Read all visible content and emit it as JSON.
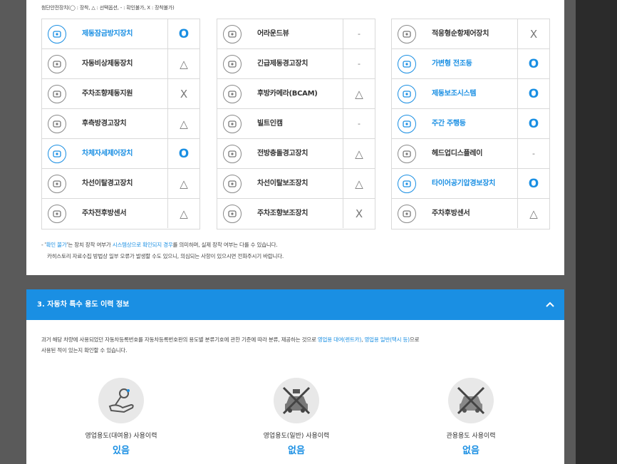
{
  "legend": "첨단안전장치(◯ : 장착, △ : 선택옵션, - : 확인불가, X : 장착불가)",
  "columns": [
    {
      "rows": [
        {
          "icon": "abs-icon",
          "label": "제동잠금방지장치",
          "value": "O",
          "highlight": true
        },
        {
          "icon": "emergency-brake-icon",
          "label": "자동비상제동장치",
          "value": "△",
          "highlight": false
        },
        {
          "icon": "steering-icon",
          "label": "주차조향제동지원",
          "value": "X",
          "highlight": false
        },
        {
          "icon": "rear-warning-icon",
          "label": "후측방경고장치",
          "value": "△",
          "highlight": false
        },
        {
          "icon": "stability-icon",
          "label": "차체자세제어장치",
          "value": "O",
          "highlight": true
        },
        {
          "icon": "lane-warning-icon",
          "label": "차선이탈경고장치",
          "value": "△",
          "highlight": false
        },
        {
          "icon": "parking-sensor-icon",
          "label": "주차전후방센서",
          "value": "△",
          "highlight": false
        }
      ]
    },
    {
      "rows": [
        {
          "icon": "around-view-icon",
          "label": "어라운드뷰",
          "value": "-",
          "highlight": false
        },
        {
          "icon": "brake-warning-icon",
          "label": "긴급제동경고장치",
          "value": "-",
          "highlight": false
        },
        {
          "icon": "rear-camera-icon",
          "label": "후방카메라(BCAM)",
          "value": "△",
          "highlight": false
        },
        {
          "icon": "built-in-cam-icon",
          "label": "빌트인캠",
          "value": "-",
          "highlight": false
        },
        {
          "icon": "collision-warning-icon",
          "label": "전방충돌경고장치",
          "value": "△",
          "highlight": false
        },
        {
          "icon": "lane-assist-icon",
          "label": "차선이탈보조장치",
          "value": "△",
          "highlight": false
        },
        {
          "icon": "parking-assist-icon",
          "label": "주차조향보조장치",
          "value": "X",
          "highlight": false
        }
      ]
    },
    {
      "rows": [
        {
          "icon": "adaptive-steering-icon",
          "label": "적응형순항제어장치",
          "value": "X",
          "highlight": false
        },
        {
          "icon": "adaptive-headlight-icon",
          "label": "가변형 전조등",
          "value": "O",
          "highlight": true
        },
        {
          "icon": "brake-assist-icon",
          "label": "제동보조시스템",
          "value": "O",
          "highlight": true
        },
        {
          "icon": "drl-icon",
          "label": "주간 주행등",
          "value": "O",
          "highlight": true
        },
        {
          "icon": "hud-icon",
          "label": "헤드업디스플레이",
          "value": "-",
          "highlight": false
        },
        {
          "icon": "tire-pressure-icon",
          "label": "타이어공기압경보장치",
          "value": "O",
          "highlight": true
        },
        {
          "icon": "rear-sensor-icon",
          "label": "주차후방센서",
          "value": "△",
          "highlight": false
        }
      ]
    }
  ],
  "note": {
    "line1_prefix": "- '",
    "line1_blue1": "확인 불가",
    "line1_mid": "'는 장치 장착 여부가 ",
    "line1_blue2": "시스템상으로 확인되지 경우",
    "line1_suffix": "를 의미하며, 실제 장착 여부는 다를 수 있습니다.",
    "line2": "카히스토리 자료수집 방법상 일부 오류가 발생할 수도 있으니, 의심되는 사항이 있으시면 전화주시기 바랍니다."
  },
  "section": {
    "title": "3. 자동차 특수 용도 이력 정보",
    "desc_line1_prefix": "과거 해당 차량에 사용되었던 자동차등록번호를 자동차등록번호판의 용도별 분류기호에 관한 기준에 따라 분류, 제공하는 것으로 ",
    "desc_blue1": "영업용 대여(렌트카)",
    "desc_sep": ", ",
    "desc_blue2": "영업용 일반(택시 등)",
    "desc_line1_suffix": "으로",
    "desc_line2": "사용된 적이 있는지 확인할 수 있습니다.",
    "usages": [
      {
        "icon": "rental-key-icon",
        "label": "영업용도(대여용) 사용이력",
        "value": "있음"
      },
      {
        "icon": "taxi-crossed-icon",
        "label": "영업용도(일반) 사용이력",
        "value": "없음"
      },
      {
        "icon": "government-car-crossed-icon",
        "label": "관용용도 사용이력",
        "value": "없음"
      }
    ]
  },
  "colors": {
    "accent": "#1a8fe3",
    "border": "#d9d9d9"
  }
}
